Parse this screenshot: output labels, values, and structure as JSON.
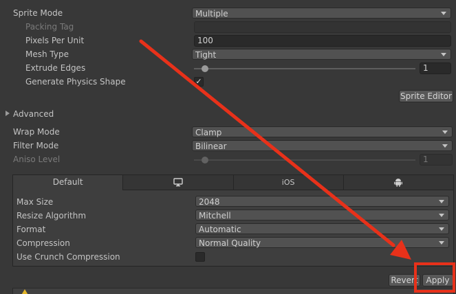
{
  "sprite_mode": {
    "label": "Sprite Mode",
    "value": "Multiple"
  },
  "packing_tag": {
    "label": "Packing Tag",
    "value": ""
  },
  "pixels_per_unit": {
    "label": "Pixels Per Unit",
    "value": "100"
  },
  "mesh_type": {
    "label": "Mesh Type",
    "value": "Tight"
  },
  "extrude_edges": {
    "label": "Extrude Edges",
    "value": "1",
    "slider_fraction": 0.05
  },
  "generate_physics_shape": {
    "label": "Generate Physics Shape",
    "checked": true,
    "check_glyph": "✓"
  },
  "sprite_editor_button": "Sprite Editor",
  "advanced": {
    "label": "Advanced",
    "expanded": false
  },
  "wrap_mode": {
    "label": "Wrap Mode",
    "value": "Clamp"
  },
  "filter_mode": {
    "label": "Filter Mode",
    "value": "Bilinear"
  },
  "aniso_level": {
    "label": "Aniso Level",
    "value": "1",
    "enabled": false,
    "slider_fraction": 0.05
  },
  "platform_tabs": [
    {
      "label": "Default",
      "icon": null,
      "active": true
    },
    {
      "label": "",
      "icon": "monitor-icon",
      "active": false
    },
    {
      "label": "iOS",
      "icon": null,
      "active": false
    },
    {
      "label": "",
      "icon": "android-icon",
      "active": false
    }
  ],
  "platform_settings": {
    "max_size": {
      "label": "Max Size",
      "value": "2048"
    },
    "resize_algorithm": {
      "label": "Resize Algorithm",
      "value": "Mitchell"
    },
    "format": {
      "label": "Format",
      "value": "Automatic"
    },
    "compression": {
      "label": "Compression",
      "value": "Normal Quality"
    },
    "use_crunch": {
      "label": "Use Crunch Compression",
      "checked": false
    }
  },
  "revert_button": "Revert",
  "apply_button": "Apply",
  "annotation": {
    "arrow_color": "#e8311a",
    "highlight_color": "#e8311a"
  },
  "colors": {
    "background": "#383838",
    "field": "#515151",
    "text": "#c4c4c4"
  }
}
